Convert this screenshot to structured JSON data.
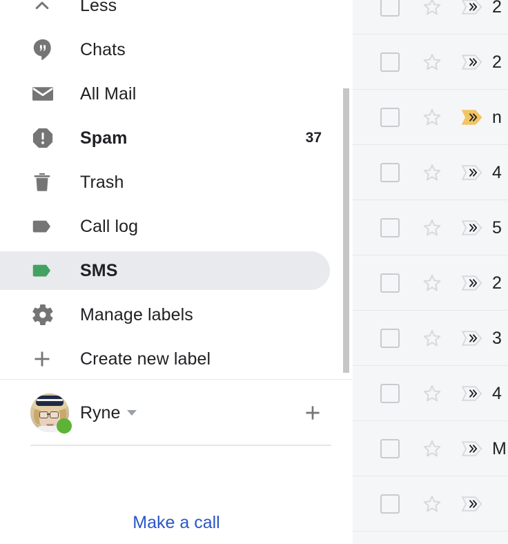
{
  "sidebar": {
    "nav_items": [
      {
        "label": "Less",
        "icon": "chevron-up-icon",
        "count": "",
        "bold": false,
        "selected": false
      },
      {
        "label": "Chats",
        "icon": "hangouts-icon",
        "count": "",
        "bold": false,
        "selected": false
      },
      {
        "label": "All Mail",
        "icon": "mail-icon",
        "count": "",
        "bold": false,
        "selected": false
      },
      {
        "label": "Spam",
        "icon": "spam-icon",
        "count": "37",
        "bold": true,
        "selected": false
      },
      {
        "label": "Trash",
        "icon": "trash-icon",
        "count": "",
        "bold": false,
        "selected": false
      },
      {
        "label": "Call log",
        "icon": "label-tag-icon",
        "count": "",
        "bold": false,
        "selected": false
      },
      {
        "label": "SMS",
        "icon": "label-tag-icon",
        "count": "",
        "bold": true,
        "selected": true
      },
      {
        "label": "Manage labels",
        "icon": "gear-icon",
        "count": "",
        "bold": false,
        "selected": false
      },
      {
        "label": "Create new label",
        "icon": "plus-icon",
        "count": "",
        "bold": false,
        "selected": false
      }
    ],
    "account": {
      "name": "Ryne",
      "caret": "chevron-down-icon",
      "status": "available",
      "add_account_icon": "plus-icon"
    },
    "make_a_call_label": "Make a call"
  },
  "mail_list": {
    "rows": [
      {
        "text": "",
        "important": false,
        "starred": false,
        "checked": false
      },
      {
        "text": "2",
        "important": false,
        "starred": false,
        "checked": false
      },
      {
        "text": "2",
        "important": false,
        "starred": false,
        "checked": false
      },
      {
        "text": "n",
        "important": true,
        "starred": false,
        "checked": false
      },
      {
        "text": "4",
        "important": false,
        "starred": false,
        "checked": false
      },
      {
        "text": "5",
        "important": false,
        "starred": false,
        "checked": false
      },
      {
        "text": "2",
        "important": false,
        "starred": false,
        "checked": false
      },
      {
        "text": "3",
        "important": false,
        "starred": false,
        "checked": false
      },
      {
        "text": "4",
        "important": false,
        "starred": false,
        "checked": false
      },
      {
        "text": "M",
        "important": false,
        "starred": false,
        "checked": false
      },
      {
        "text": "",
        "important": false,
        "starred": false,
        "checked": false
      }
    ]
  },
  "colors": {
    "selected_pill": "#e8eaed",
    "sms_label_green": "#43a25f",
    "icon_gray": "#757575",
    "important_yellow": "#f2c462",
    "important_gray": "#dadce0",
    "link_blue": "#2a56c6",
    "status_green": "#5cb336",
    "list_background": "#f5f6f7",
    "row_divider": "#e5e7e9",
    "scrollbar_thumb": "#c6c6c6"
  }
}
